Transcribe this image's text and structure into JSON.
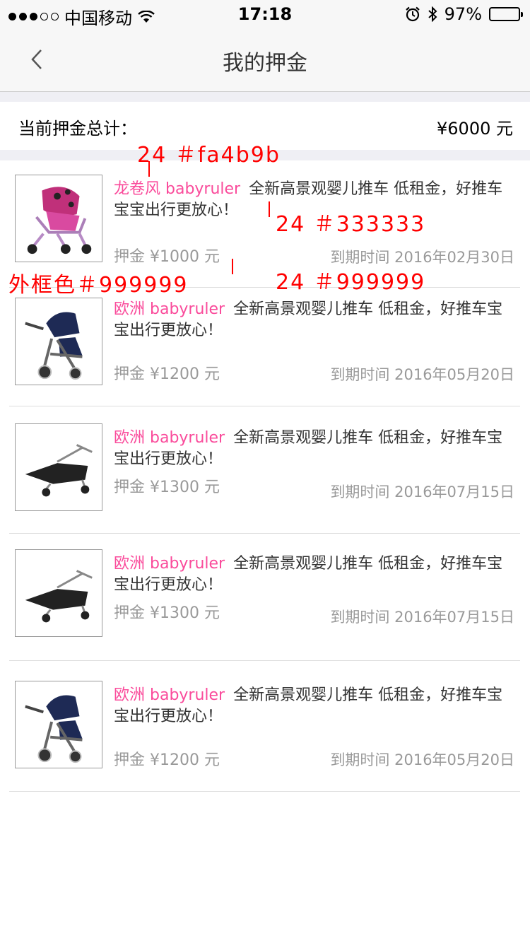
{
  "status_bar": {
    "carrier": "中国移动",
    "time": "17:18",
    "battery": "97%",
    "battery_level": 0.97,
    "icons": [
      "signal-dots-icon",
      "wifi-icon",
      "alarm-icon",
      "bluetooth-icon",
      "battery-icon"
    ]
  },
  "nav": {
    "title": "我的押金",
    "back_icon": "chevron-left-icon"
  },
  "summary": {
    "label": "当前押金总计：",
    "amount": "¥6000 元"
  },
  "items": [
    {
      "brand": "龙卷风 babyruler",
      "description": "全新高景观婴儿推车 低租金，好推车宝宝出行更放心！",
      "deposit": "押金 ¥1000 元",
      "expire": "到期时间 2016年02月30日",
      "image": "pink-stroller"
    },
    {
      "brand": "欧洲 babyruler",
      "description": "全新高景观婴儿推车 低租金，好推车宝宝出行更放心！",
      "deposit": "押金 ¥1200 元",
      "expire": "到期时间 2016年05月20日",
      "image": "navy-stroller"
    },
    {
      "brand": "欧洲 babyruler",
      "description": "全新高景观婴儿推车 低租金，好推车宝宝出行更放心！",
      "deposit": "押金 ¥1300 元",
      "expire": "到期时间 2016年07月15日",
      "image": "black-stroller-reclined"
    },
    {
      "brand": "欧洲 babyruler",
      "description": "全新高景观婴儿推车 低租金，好推车宝宝出行更放心！",
      "deposit": "押金 ¥1300 元",
      "expire": "到期时间 2016年07月15日",
      "image": "black-stroller-reclined"
    },
    {
      "brand": "欧洲 babyruler",
      "description": "全新高景观婴儿推车 低租金，好推车宝宝出行更放心！",
      "deposit": "押金 ¥1200 元",
      "expire": "到期时间 2016年05月20日",
      "image": "navy-stroller"
    }
  ],
  "annotations": {
    "brand_spec": "24 ＃fa4b9b",
    "desc_spec": "24 ＃333333",
    "border_spec": "外框色＃999999",
    "meta_spec": "24 ＃999999"
  },
  "colors": {
    "brand": "#fa4b9b",
    "text": "#333333",
    "muted": "#999999",
    "annotation": "#ff0000",
    "background_gap": "#efeff4"
  }
}
